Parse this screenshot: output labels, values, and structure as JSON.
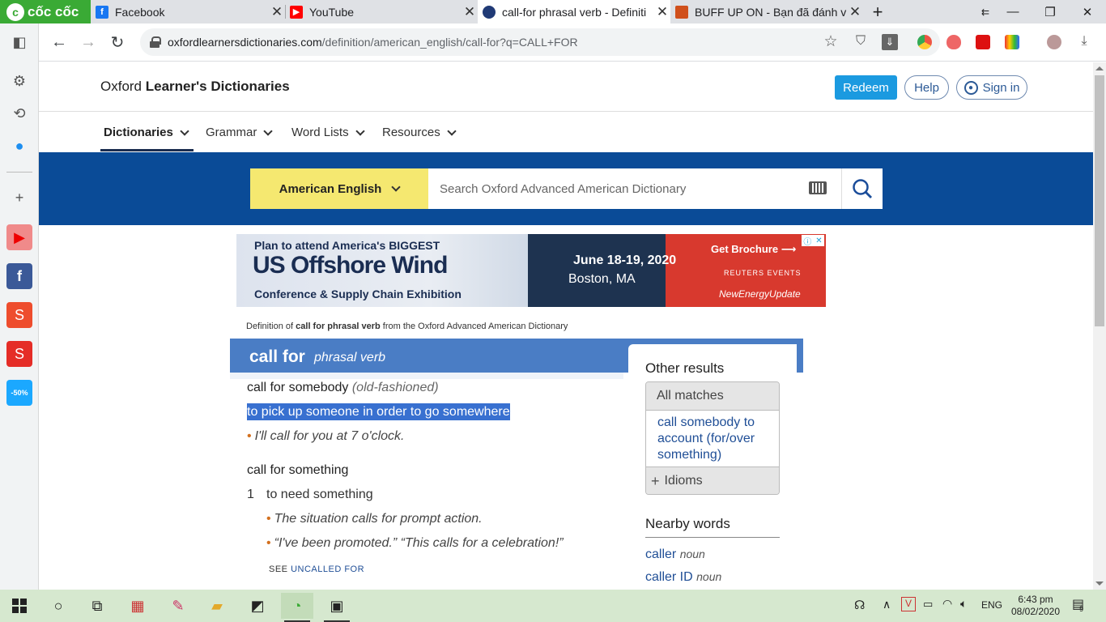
{
  "browser": {
    "brand": "cốc cốc",
    "tabs": [
      {
        "title": "Facebook",
        "active": false
      },
      {
        "title": "YouTube",
        "active": false
      },
      {
        "title": "call-for phrasal verb - Definiti",
        "active": true
      },
      {
        "title": "BUFF UP ON - Bạn đã đánh v",
        "active": false
      }
    ],
    "new_tab": "+",
    "url_host": "oxfordlearnersdictionaries.com",
    "url_path": "/definition/american_english/call-for?q=CALL+FOR"
  },
  "site": {
    "title_plain": "Oxford ",
    "title_bold": "Learner's Dictionaries",
    "redeem": "Redeem",
    "help": "Help",
    "sign_in": "Sign in",
    "menu": [
      "Dictionaries",
      "Grammar",
      "Word Lists",
      "Resources"
    ]
  },
  "search": {
    "dictionary": "American English",
    "placeholder": "Search Oxford Advanced American Dictionary"
  },
  "ad": {
    "line1": "Plan to attend America's BIGGEST",
    "line2": "US Offshore Wind",
    "line3": "Conference & Supply Chain Exhibition",
    "date": "June 18-19, 2020",
    "location": "Boston, MA",
    "cta": "Get Brochure",
    "sponsor": "REUTERS EVENTS",
    "sponsor2": "NewEnergyUpdate"
  },
  "entry": {
    "source_pre": "Definition of ",
    "source_bold": "call for phrasal verb",
    "source_post": " from the Oxford Advanced American Dictionary",
    "headword": "call for",
    "pos": "phrasal verb",
    "sense1_head": "call for somebody",
    "sense1_label": "(old-fashioned)",
    "sense1_def": "to pick up someone in order to go somewhere",
    "sense1_ex": "I'll call for you at 7 o'clock.",
    "sense2_head": "call for something",
    "sense2_num": "1",
    "sense2_def": "to need something",
    "sense2_ex1": "The situation calls for prompt action.",
    "sense2_ex2": "“I've been promoted.” “This calls for a celebration!”",
    "see_label": "SEE",
    "see_link": "UNCALLED FOR"
  },
  "other_results": {
    "title": "Other results",
    "all_matches": "All matches",
    "match_link": "call somebody to account (for/over something)",
    "idioms": "Idioms",
    "nearby_title": "Nearby words",
    "nearby": [
      {
        "word": "caller",
        "pos": "noun"
      },
      {
        "word": "caller ID",
        "pos": "noun"
      }
    ]
  },
  "taskbar": {
    "lang": "ENG",
    "time": "6:43 pm",
    "date": "08/02/2020",
    "notif_count": "9"
  }
}
